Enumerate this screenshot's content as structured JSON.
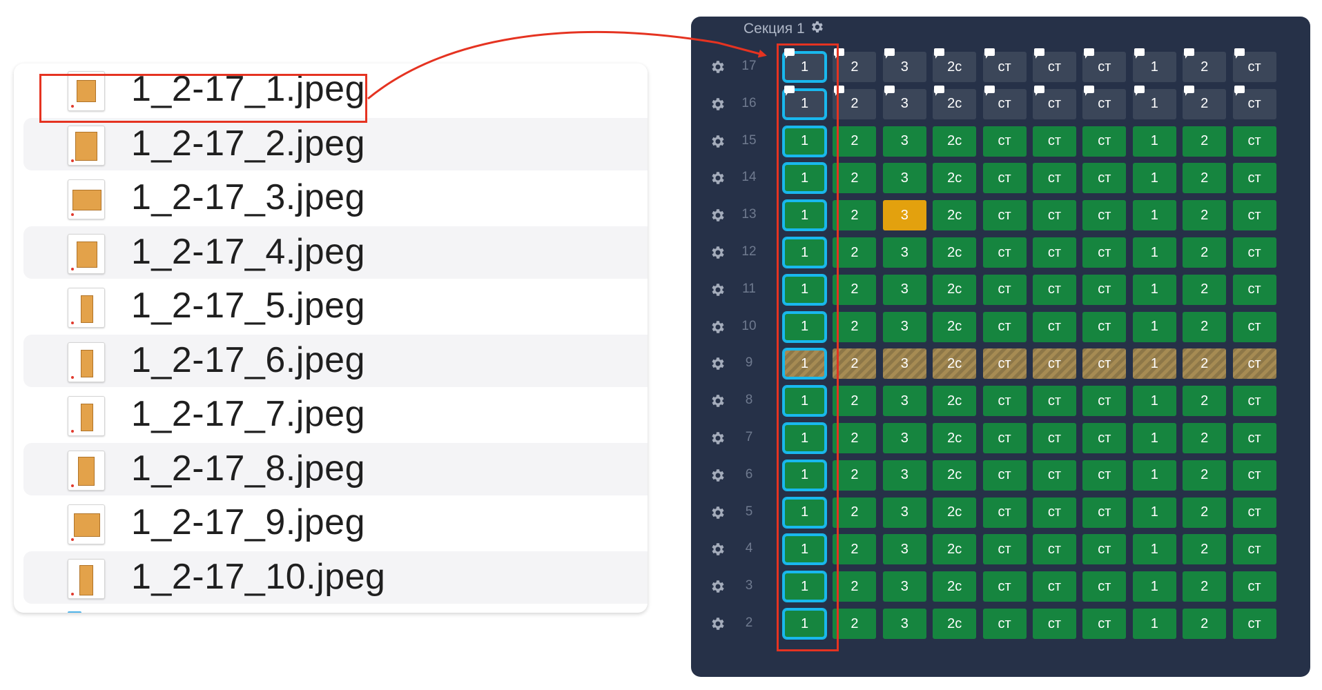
{
  "files": [
    {
      "name": "1_2-17_1.jpeg"
    },
    {
      "name": "1_2-17_2.jpeg"
    },
    {
      "name": "1_2-17_3.jpeg"
    },
    {
      "name": "1_2-17_4.jpeg"
    },
    {
      "name": "1_2-17_5.jpeg"
    },
    {
      "name": "1_2-17_6.jpeg"
    },
    {
      "name": "1_2-17_7.jpeg"
    },
    {
      "name": "1_2-17_8.jpeg"
    },
    {
      "name": "1_2-17_9.jpeg"
    },
    {
      "name": "1_2-17_10.jpeg"
    }
  ],
  "section": {
    "title": "Секция 1",
    "columns": [
      "1",
      "2",
      "3",
      "2с",
      "ст",
      "ст",
      "ст",
      "1",
      "2",
      "ст"
    ],
    "floors": [
      {
        "floor": "17",
        "status": "dark",
        "notes": true
      },
      {
        "floor": "16",
        "status": "dark",
        "notes": true
      },
      {
        "floor": "15",
        "status": "green"
      },
      {
        "floor": "14",
        "status": "green"
      },
      {
        "floor": "13",
        "status": "green",
        "highlight_col": 2,
        "highlight": "orange"
      },
      {
        "floor": "12",
        "status": "green"
      },
      {
        "floor": "11",
        "status": "green"
      },
      {
        "floor": "10",
        "status": "green"
      },
      {
        "floor": "9",
        "status": "hatched"
      },
      {
        "floor": "8",
        "status": "green"
      },
      {
        "floor": "7",
        "status": "green"
      },
      {
        "floor": "6",
        "status": "green"
      },
      {
        "floor": "5",
        "status": "green"
      },
      {
        "floor": "4",
        "status": "green"
      },
      {
        "floor": "3",
        "status": "green"
      },
      {
        "floor": "2",
        "status": "green"
      }
    ]
  },
  "annotations": {
    "selected_file_index": 0,
    "selected_column_index": 0,
    "arrow_color": "#e53321"
  },
  "colors": {
    "panel_bg": "#263148",
    "cell_green": "#16853f",
    "cell_dark": "#3b4659",
    "cell_orange": "#e3a10e",
    "selection_outline": "#19b8ee",
    "annotation_red": "#e53321"
  }
}
